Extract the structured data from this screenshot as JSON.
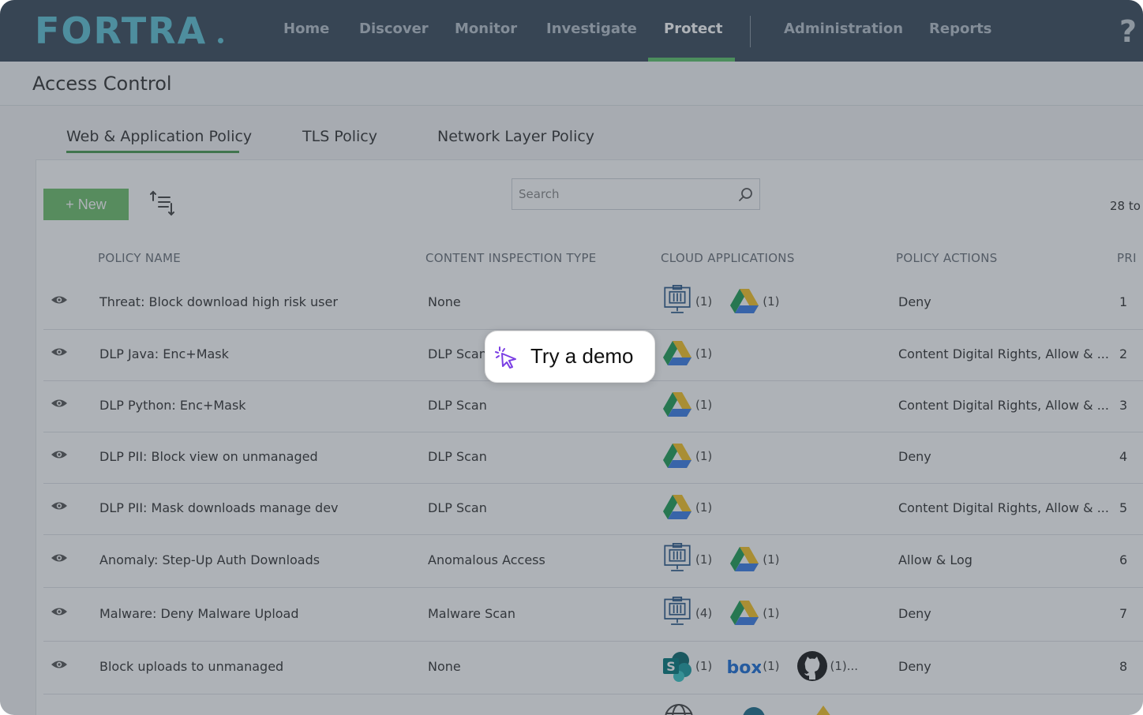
{
  "brand": {
    "logo_text": "FORTRA"
  },
  "nav": {
    "items": [
      "Home",
      "Discover",
      "Monitor",
      "Investigate",
      "Protect",
      "Administration",
      "Reports"
    ],
    "active": "Protect",
    "help_glyph": "?"
  },
  "page": {
    "title": "Access Control"
  },
  "tabs": [
    "Web & Application Policy",
    "TLS Policy",
    "Network Layer Policy"
  ],
  "toolbar": {
    "new_label": "+ New",
    "search_placeholder": "Search",
    "count_text": "28 to"
  },
  "table": {
    "columns": [
      "POLICY NAME",
      "CONTENT INSPECTION TYPE",
      "CLOUD APPLICATIONS",
      "POLICY ACTIONS",
      "PRI"
    ],
    "rows": [
      {
        "name": "Threat: Block download high risk user",
        "type": "None",
        "apps": [
          {
            "icon": "building-icon",
            "count": "(1)"
          },
          {
            "icon": "google-drive-icon",
            "count": "(1)"
          }
        ],
        "action": "Deny",
        "priority": "1"
      },
      {
        "name": "DLP Java: Enc+Mask",
        "type": "DLP Scan",
        "apps": [
          {
            "icon": "google-drive-icon",
            "count": "(1)"
          }
        ],
        "action": "Content Digital Rights, Allow & ...",
        "priority": "2"
      },
      {
        "name": "DLP Python: Enc+Mask",
        "type": "DLP Scan",
        "apps": [
          {
            "icon": "google-drive-icon",
            "count": "(1)"
          }
        ],
        "action": "Content Digital Rights, Allow & ...",
        "priority": "3"
      },
      {
        "name": "DLP PII: Block view on unmanaged",
        "type": "DLP Scan",
        "apps": [
          {
            "icon": "google-drive-icon",
            "count": "(1)"
          }
        ],
        "action": "Deny",
        "priority": "4"
      },
      {
        "name": "DLP PII: Mask downloads manage dev",
        "type": "DLP Scan",
        "apps": [
          {
            "icon": "google-drive-icon",
            "count": "(1)"
          }
        ],
        "action": "Content Digital Rights, Allow & ...",
        "priority": "5"
      },
      {
        "name": "Anomaly: Step-Up Auth Downloads",
        "type": "Anomalous Access",
        "apps": [
          {
            "icon": "building-icon",
            "count": "(1)"
          },
          {
            "icon": "google-drive-icon",
            "count": "(1)"
          }
        ],
        "action": "Allow & Log",
        "priority": "6"
      },
      {
        "name": "Malware: Deny Malware Upload",
        "type": "Malware Scan",
        "apps": [
          {
            "icon": "building-icon",
            "count": "(4)"
          },
          {
            "icon": "google-drive-icon",
            "count": "(1)"
          }
        ],
        "action": "Deny",
        "priority": "7"
      },
      {
        "name": "Block uploads to unmanaged",
        "type": "None",
        "apps": [
          {
            "icon": "sharepoint-icon",
            "count": "(1)"
          },
          {
            "icon": "box-icon",
            "count": "(1)"
          },
          {
            "icon": "github-icon",
            "count": "(1)..."
          }
        ],
        "action": "Deny",
        "priority": "8"
      }
    ]
  },
  "overlay": {
    "demo_label": "Try a demo"
  },
  "colors": {
    "nav_bg": "#3a4a5a",
    "accent_green": "#5cc36a",
    "logo": "#5fc3d6"
  }
}
